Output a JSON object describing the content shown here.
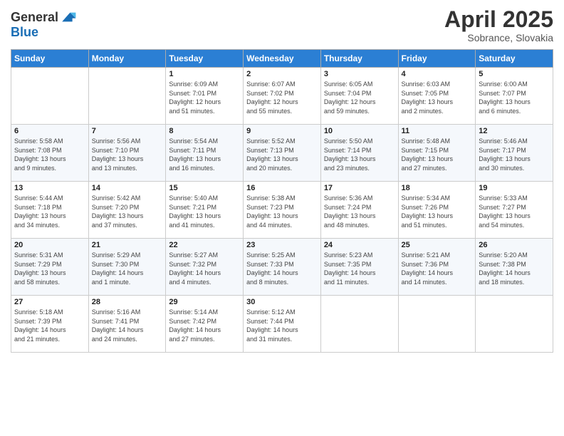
{
  "logo": {
    "general": "General",
    "blue": "Blue"
  },
  "header": {
    "month": "April 2025",
    "location": "Sobrance, Slovakia"
  },
  "days_of_week": [
    "Sunday",
    "Monday",
    "Tuesday",
    "Wednesday",
    "Thursday",
    "Friday",
    "Saturday"
  ],
  "weeks": [
    [
      {
        "day": "",
        "info": ""
      },
      {
        "day": "",
        "info": ""
      },
      {
        "day": "1",
        "info": "Sunrise: 6:09 AM\nSunset: 7:01 PM\nDaylight: 12 hours\nand 51 minutes."
      },
      {
        "day": "2",
        "info": "Sunrise: 6:07 AM\nSunset: 7:02 PM\nDaylight: 12 hours\nand 55 minutes."
      },
      {
        "day": "3",
        "info": "Sunrise: 6:05 AM\nSunset: 7:04 PM\nDaylight: 12 hours\nand 59 minutes."
      },
      {
        "day": "4",
        "info": "Sunrise: 6:03 AM\nSunset: 7:05 PM\nDaylight: 13 hours\nand 2 minutes."
      },
      {
        "day": "5",
        "info": "Sunrise: 6:00 AM\nSunset: 7:07 PM\nDaylight: 13 hours\nand 6 minutes."
      }
    ],
    [
      {
        "day": "6",
        "info": "Sunrise: 5:58 AM\nSunset: 7:08 PM\nDaylight: 13 hours\nand 9 minutes."
      },
      {
        "day": "7",
        "info": "Sunrise: 5:56 AM\nSunset: 7:10 PM\nDaylight: 13 hours\nand 13 minutes."
      },
      {
        "day": "8",
        "info": "Sunrise: 5:54 AM\nSunset: 7:11 PM\nDaylight: 13 hours\nand 16 minutes."
      },
      {
        "day": "9",
        "info": "Sunrise: 5:52 AM\nSunset: 7:13 PM\nDaylight: 13 hours\nand 20 minutes."
      },
      {
        "day": "10",
        "info": "Sunrise: 5:50 AM\nSunset: 7:14 PM\nDaylight: 13 hours\nand 23 minutes."
      },
      {
        "day": "11",
        "info": "Sunrise: 5:48 AM\nSunset: 7:15 PM\nDaylight: 13 hours\nand 27 minutes."
      },
      {
        "day": "12",
        "info": "Sunrise: 5:46 AM\nSunset: 7:17 PM\nDaylight: 13 hours\nand 30 minutes."
      }
    ],
    [
      {
        "day": "13",
        "info": "Sunrise: 5:44 AM\nSunset: 7:18 PM\nDaylight: 13 hours\nand 34 minutes."
      },
      {
        "day": "14",
        "info": "Sunrise: 5:42 AM\nSunset: 7:20 PM\nDaylight: 13 hours\nand 37 minutes."
      },
      {
        "day": "15",
        "info": "Sunrise: 5:40 AM\nSunset: 7:21 PM\nDaylight: 13 hours\nand 41 minutes."
      },
      {
        "day": "16",
        "info": "Sunrise: 5:38 AM\nSunset: 7:23 PM\nDaylight: 13 hours\nand 44 minutes."
      },
      {
        "day": "17",
        "info": "Sunrise: 5:36 AM\nSunset: 7:24 PM\nDaylight: 13 hours\nand 48 minutes."
      },
      {
        "day": "18",
        "info": "Sunrise: 5:34 AM\nSunset: 7:26 PM\nDaylight: 13 hours\nand 51 minutes."
      },
      {
        "day": "19",
        "info": "Sunrise: 5:33 AM\nSunset: 7:27 PM\nDaylight: 13 hours\nand 54 minutes."
      }
    ],
    [
      {
        "day": "20",
        "info": "Sunrise: 5:31 AM\nSunset: 7:29 PM\nDaylight: 13 hours\nand 58 minutes."
      },
      {
        "day": "21",
        "info": "Sunrise: 5:29 AM\nSunset: 7:30 PM\nDaylight: 14 hours\nand 1 minute."
      },
      {
        "day": "22",
        "info": "Sunrise: 5:27 AM\nSunset: 7:32 PM\nDaylight: 14 hours\nand 4 minutes."
      },
      {
        "day": "23",
        "info": "Sunrise: 5:25 AM\nSunset: 7:33 PM\nDaylight: 14 hours\nand 8 minutes."
      },
      {
        "day": "24",
        "info": "Sunrise: 5:23 AM\nSunset: 7:35 PM\nDaylight: 14 hours\nand 11 minutes."
      },
      {
        "day": "25",
        "info": "Sunrise: 5:21 AM\nSunset: 7:36 PM\nDaylight: 14 hours\nand 14 minutes."
      },
      {
        "day": "26",
        "info": "Sunrise: 5:20 AM\nSunset: 7:38 PM\nDaylight: 14 hours\nand 18 minutes."
      }
    ],
    [
      {
        "day": "27",
        "info": "Sunrise: 5:18 AM\nSunset: 7:39 PM\nDaylight: 14 hours\nand 21 minutes."
      },
      {
        "day": "28",
        "info": "Sunrise: 5:16 AM\nSunset: 7:41 PM\nDaylight: 14 hours\nand 24 minutes."
      },
      {
        "day": "29",
        "info": "Sunrise: 5:14 AM\nSunset: 7:42 PM\nDaylight: 14 hours\nand 27 minutes."
      },
      {
        "day": "30",
        "info": "Sunrise: 5:12 AM\nSunset: 7:44 PM\nDaylight: 14 hours\nand 31 minutes."
      },
      {
        "day": "",
        "info": ""
      },
      {
        "day": "",
        "info": ""
      },
      {
        "day": "",
        "info": ""
      }
    ]
  ]
}
